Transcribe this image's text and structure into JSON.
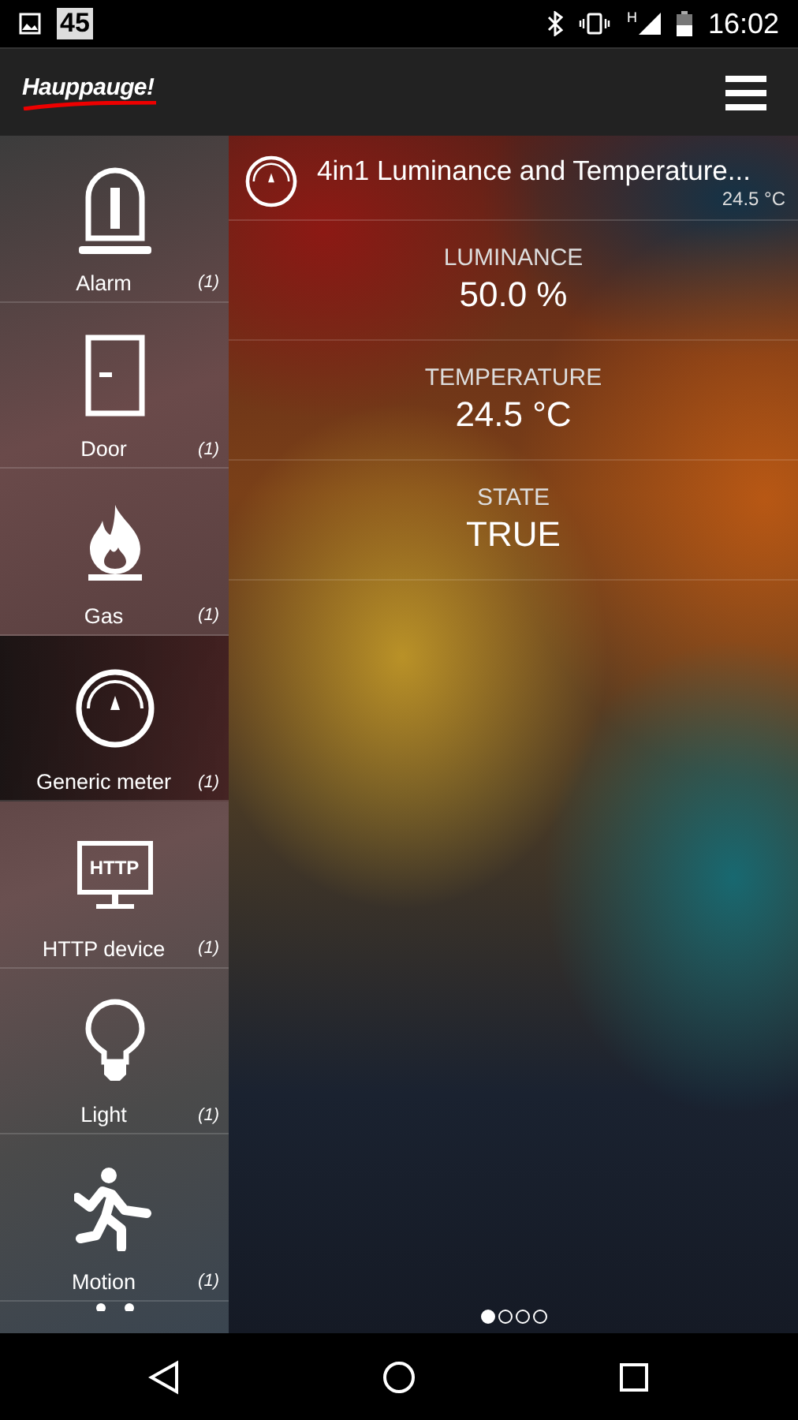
{
  "status_bar": {
    "badge": "45",
    "network": "H",
    "time": "16:02"
  },
  "app_bar": {
    "logo": "Hauppauge!"
  },
  "sidebar": {
    "items": [
      {
        "kind": "alarm",
        "label": "Alarm",
        "count": "(1)",
        "selected": false
      },
      {
        "kind": "door",
        "label": "Door",
        "count": "(1)",
        "selected": false
      },
      {
        "kind": "gas",
        "label": "Gas",
        "count": "(1)",
        "selected": false
      },
      {
        "kind": "meter",
        "label": "Generic meter",
        "count": "(1)",
        "selected": true
      },
      {
        "kind": "http",
        "label": "HTTP device",
        "count": "(1)",
        "selected": false,
        "icon_text": "HTTP"
      },
      {
        "kind": "light",
        "label": "Light",
        "count": "(1)",
        "selected": false
      },
      {
        "kind": "motion",
        "label": "Motion",
        "count": "(1)",
        "selected": false
      }
    ]
  },
  "device": {
    "title": "4in1 Luminance and Temperature...",
    "subtitle": "24.5 °C",
    "readings": [
      {
        "label": "LUMINANCE",
        "value": "50.0 %"
      },
      {
        "label": "TEMPERATURE",
        "value": "24.5 °C"
      },
      {
        "label": "STATE",
        "value": "TRUE"
      }
    ]
  },
  "pager": [
    {
      "selected": true
    },
    {
      "selected": false
    },
    {
      "selected": false
    },
    {
      "selected": false
    }
  ]
}
